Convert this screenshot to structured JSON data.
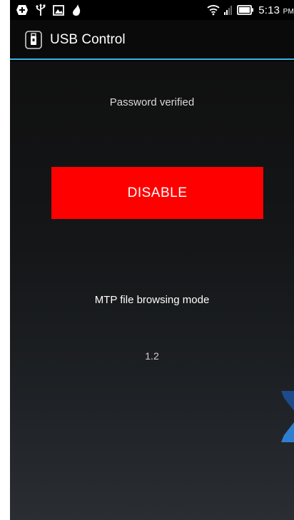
{
  "status_bar": {
    "time": "5:13",
    "ampm": "PM",
    "left_icons": [
      "notification-plus-icon",
      "usb-icon",
      "image-icon",
      "flame-icon"
    ],
    "right_icons": [
      "wifi-icon",
      "signal-icon",
      "battery-icon"
    ]
  },
  "action_bar": {
    "title": "USB Control",
    "icon": "usb-lock-icon",
    "accent_color": "#33b5e5"
  },
  "main": {
    "status_text": "Password verified",
    "disable_button_label": "DISABLE",
    "disable_button_color": "#ff0000",
    "mode_text": "MTP file browsing mode",
    "version_text": "1.2"
  }
}
